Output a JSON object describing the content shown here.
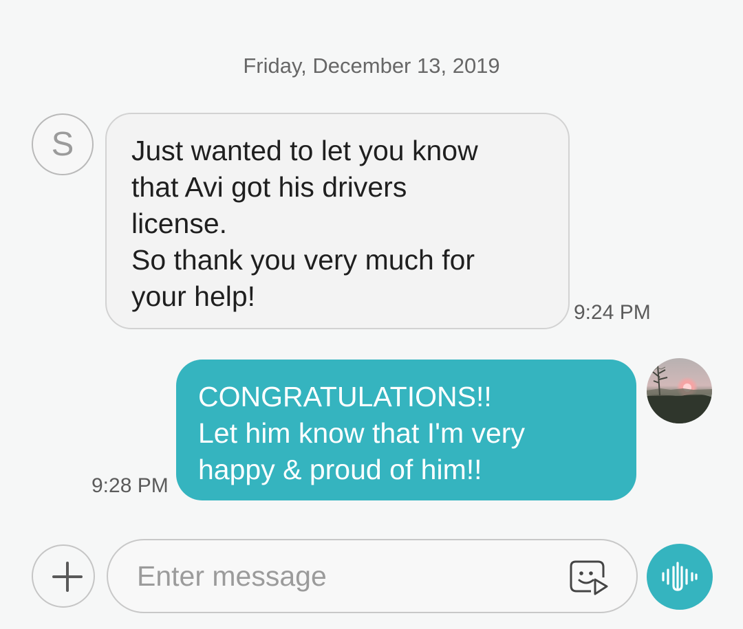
{
  "conversation": {
    "date_header": "Friday, December 13, 2019",
    "contact_initial": "S",
    "messages": [
      {
        "direction": "incoming",
        "text": "Just wanted to let you know\nthat Avi got his drivers\nlicense.\nSo thank you very much for\nyour help!",
        "time": "9:24 PM"
      },
      {
        "direction": "outgoing",
        "text": "CONGRATULATIONS!!\nLet him know that I'm very\nhappy & proud of him!!",
        "time": "9:28 PM"
      }
    ]
  },
  "composer": {
    "placeholder": "Enter message",
    "value": "",
    "add_icon": "plus-icon",
    "sticker_icon": "sticker-icon",
    "voice_icon": "voice-wave-icon"
  },
  "theme": {
    "background": "#f6f7f7",
    "accent": "#35b4bf",
    "incoming_bubble": "#f3f3f3",
    "incoming_border": "#d2d2d2",
    "muted_text": "#676767"
  }
}
